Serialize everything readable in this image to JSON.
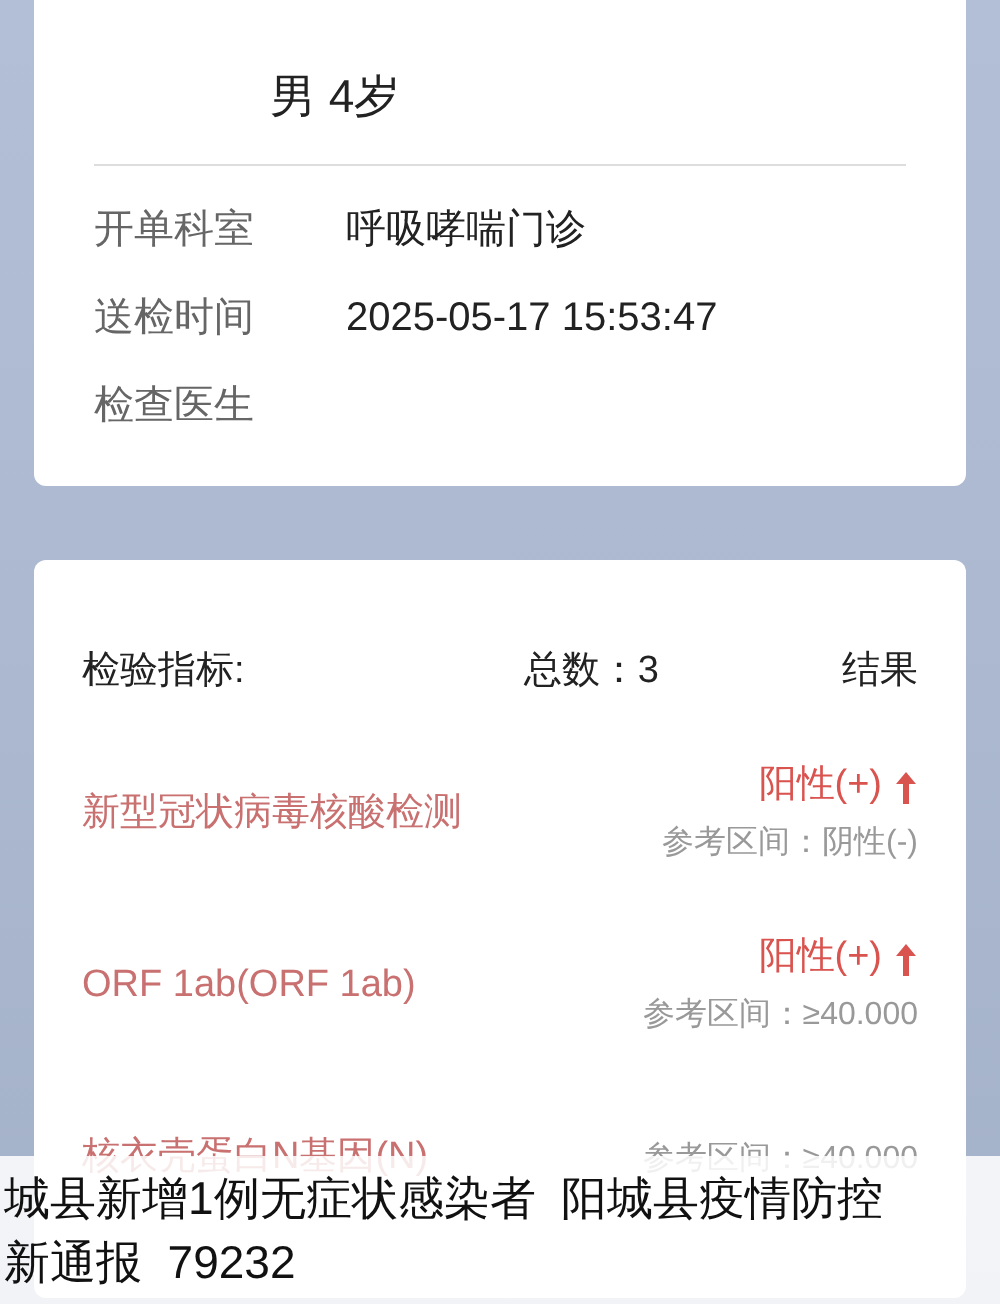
{
  "patient": {
    "summary": "男 4岁"
  },
  "info": [
    {
      "label": "开单科室",
      "value": "呼吸哮喘门诊"
    },
    {
      "label": "送检时间",
      "value": "2025-05-17 15:53:47"
    },
    {
      "label": "检查医生"
    }
  ],
  "tests": {
    "title": "检验指标:",
    "total": "总数：3",
    "result_heading": "结果",
    "items": [
      {
        "name": "新型冠状病毒核酸检测",
        "result": "阳性(+)",
        "abnormal": true,
        "range": "参考区间：阴性(-)"
      },
      {
        "name": "ORF 1ab(ORF 1ab)",
        "result": "阳性(+)",
        "abnormal": true,
        "range": "参考区间：≥40.000"
      },
      {
        "name": "核衣壳蛋白N基因(N)",
        "range": "参考区间：≥40.000"
      }
    ]
  },
  "caption": {
    "lines": [
      "城县新增1例无症状感染者  阳城县疫情防控",
      "新通报  79232"
    ]
  }
}
